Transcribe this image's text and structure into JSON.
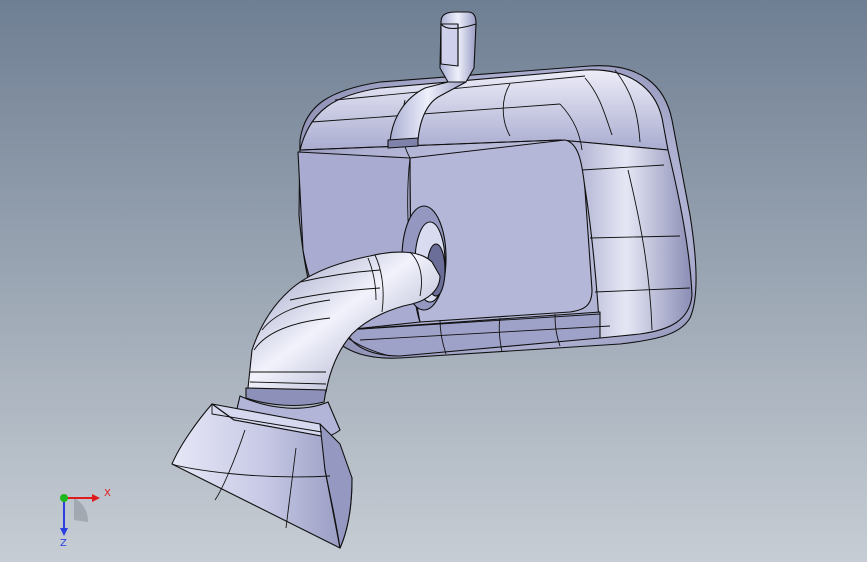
{
  "viewport": {
    "background_top": "#6f7f93",
    "background_bottom": "#c7cdd4",
    "model_color": "#b4b7d6",
    "edge_color": "#101010"
  },
  "triad": {
    "x_label": "X",
    "z_label": "Z",
    "x_color": "#e01b1b",
    "y_color": "#1db81d",
    "z_color": "#2a3fe0"
  }
}
